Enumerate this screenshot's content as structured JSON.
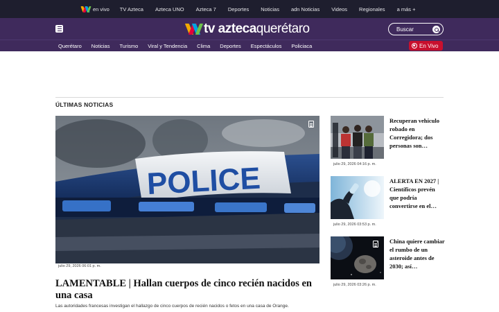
{
  "topnav": {
    "items": [
      {
        "label": "en vivo",
        "icon": "tv-azteca-logo-icon"
      },
      {
        "label": "TV Azteca"
      },
      {
        "label": "Azteca UNO"
      },
      {
        "label": "Azteca 7"
      },
      {
        "label": "Deportes"
      },
      {
        "label": "Noticias"
      },
      {
        "label": "adn Noticias"
      },
      {
        "label": "Videos"
      },
      {
        "label": "Regionales"
      },
      {
        "label": "a más +"
      }
    ]
  },
  "header": {
    "brand_bold": "tv azteca",
    "brand_light": "querétaro",
    "search_placeholder": "Buscar",
    "menu_icon": "menu-icon",
    "search_icon": "search-icon"
  },
  "secnav": {
    "items": [
      "Querétaro",
      "Noticias",
      "Turismo",
      "Viral y Tendencia",
      "Clima",
      "Deportes",
      "Espectáculos",
      "Policiaca"
    ],
    "live_label": "En Vivo"
  },
  "colors": {
    "topbar": "#1e1e2e",
    "brand_purple": "#3f2a5c",
    "live_red": "#c8102e"
  },
  "main": {
    "section_title": "ÚLTIMAS NOTICIAS",
    "hero": {
      "police_text": "POLICE",
      "date": "julio 29, 2026 06:01 p. m.",
      "title": "LAMENTABLE | Hallan cuerpos de cinco recién nacidos en una casa",
      "description": "Las autoridades francesas investigan el hallazgo de cinco cuerpos de recién nacidos o fetos en una casa de Orange."
    },
    "sidebar": [
      {
        "title": "Recuperan vehículo robado en Corregidora; dos personas son…",
        "date": "julio 29, 2026 04:16 p. m."
      },
      {
        "title": "ALERTA EN 2027 | Científicos prevén que podría convertirse en el…",
        "date": "julio 29, 2026 03:53 p. m."
      },
      {
        "title": "China quiere cambiar el rumbo de un asteroide antes de 2030; así…",
        "date": "julio 29, 2026 03:26 p. m."
      }
    ]
  }
}
